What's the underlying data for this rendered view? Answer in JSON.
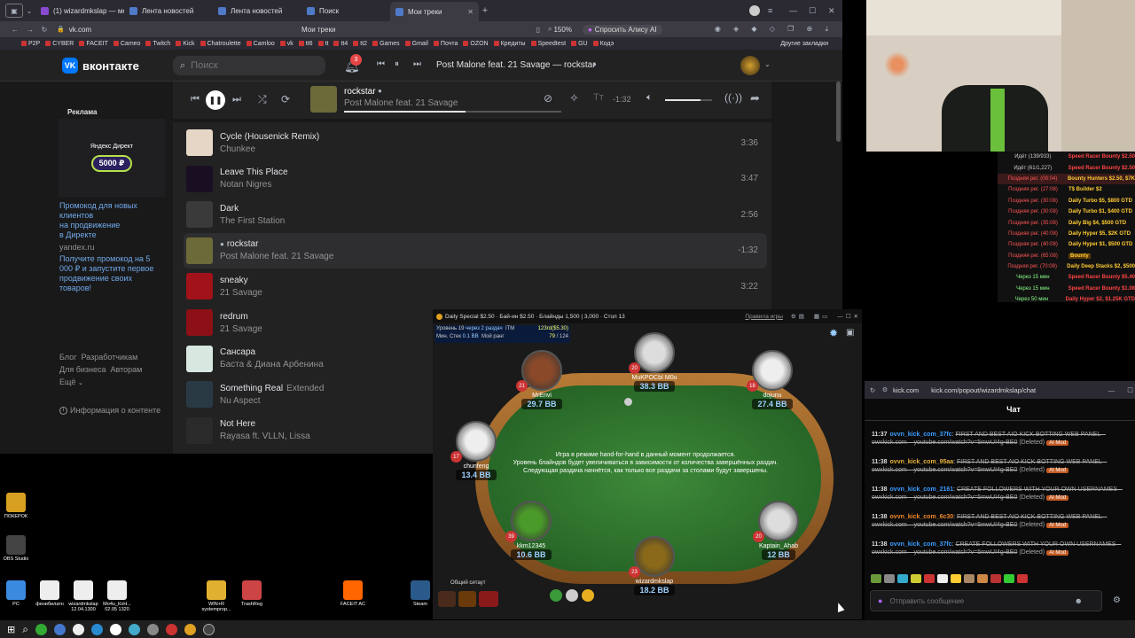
{
  "browser": {
    "tabs": [
      {
        "label": "(1) wizardmkslap — меню"
      },
      {
        "label": "Лента новостей"
      },
      {
        "label": "Лента новостей"
      },
      {
        "label": "Поиск"
      },
      {
        "label": "Мои треки"
      }
    ],
    "url": "vk.com",
    "page_title": "Мои треки",
    "zoom": "150%",
    "ask_alice": "Спросить Алису AI",
    "bookmarks": [
      "P2P",
      "CYBER",
      "FACEIT",
      "Cameo",
      "Twitch",
      "Kick",
      "Chatroulette",
      "Camloo",
      "vk",
      "tt6",
      "tt",
      "tt4",
      "tt2",
      "Games",
      "Gmail",
      "Почта",
      "OZON",
      "Кредиты",
      "Speedtest",
      "GU",
      "Кодэ"
    ],
    "other_bookmarks": "Другие закладки"
  },
  "vk": {
    "logo": "вконтакте",
    "search_placeholder": "Поиск",
    "notif_count": "3",
    "now_playing_header": "Post Malone feat. 21 Savage — rockstar"
  },
  "sidebar": {
    "ad_title": "Реклама",
    "ad_brand": "Яндекс Директ",
    "ad_amount": "5000 ₽",
    "promo_lines": [
      "Промокод для новых",
      "клиентов",
      "на продвижение",
      "в Директе"
    ],
    "promo_domain": "yandex.ru",
    "promo_desc": [
      "Получите промокод на 5",
      "000 ₽ и запустите первое",
      "продвижение своих",
      "товаров!"
    ],
    "footer_links": [
      "Блог",
      "Разработчикам",
      "Для бизнеса",
      "Авторам",
      "Ещё"
    ],
    "content_info": "Информация о контенте"
  },
  "player": {
    "title": "rockstar",
    "artist": "Post Malone feat. 21 Savage",
    "time": "-1:32",
    "progress": 0.56,
    "volume": 0.75
  },
  "tracks": [
    {
      "title": "Cycle (Housenick Remix)",
      "artist": "Chunkee",
      "duration": "3:36",
      "color": "#e6d6c6"
    },
    {
      "title": "Leave This Place",
      "artist": "Notan Nigres",
      "duration": "3:47",
      "color": "#1a0f22"
    },
    {
      "title": "Dark",
      "artist": "The First Station",
      "duration": "2:56",
      "color": "#3a3a3a"
    },
    {
      "title": "rockstar",
      "artist": "Post Malone feat. 21 Savage",
      "duration": "-1:32",
      "color": "#6d6a3a",
      "active": true
    },
    {
      "title": "sneaky",
      "artist": "21 Savage",
      "duration": "3:22",
      "color": "#a1121a"
    },
    {
      "title": "redrum",
      "artist": "21 Savage",
      "duration": "",
      "color": "#8c1016"
    },
    {
      "title": "Сансара",
      "artist": "Баста & Диана Арбенина",
      "duration": "",
      "color": "#d8e8e0"
    },
    {
      "title": "Something Real",
      "subtitle": "Extended",
      "artist": "Nu Aspect",
      "duration": "",
      "color": "#2a3a44"
    },
    {
      "title": "Not Here",
      "artist": "Rayasa ft. VLLN, Lissa",
      "duration": "",
      "color": "#2a2a2a"
    }
  ],
  "tournaments": [
    {
      "status": "Идёт (139/933)",
      "name": "Speed Racer Bounty $2.50",
      "c": "#ccc",
      "nc": "#f44"
    },
    {
      "status": "Идёт (61/1,227)",
      "name": "Speed Racer Bounty $2.50",
      "c": "#ccc",
      "nc": "#f44"
    },
    {
      "status": "Поздняя рег. (08:04)",
      "name": "Bounty Hunters $2.50, $7K",
      "c": "#f55",
      "nc": "#fc3",
      "hl": true
    },
    {
      "status": "Поздняя рег. (27:08)",
      "name": "T$ Builder $2",
      "c": "#f55",
      "nc": "#fc3"
    },
    {
      "status": "Поздняя рег. (30:08)",
      "name": "Daily Turbo $5, $800 GTD",
      "c": "#f55",
      "nc": "#fc3"
    },
    {
      "status": "Поздняя рег. (30:08)",
      "name": "Daily Turbo $1, $400 GTD",
      "c": "#f55",
      "nc": "#fc3"
    },
    {
      "status": "Поздняя рег. (35:08)",
      "name": "Daily Big $4, $500 GTD",
      "c": "#f55",
      "nc": "#fc3"
    },
    {
      "status": "Поздняя рег. (40:08)",
      "name": "Daily Hyper $5, $2K GTD",
      "c": "#f55",
      "nc": "#fc3"
    },
    {
      "status": "Поздняя рег. (40:08)",
      "name": "Daily Hyper $1, $500 GTD",
      "c": "#f55",
      "nc": "#fc3"
    },
    {
      "status": "Поздняя рег. (65:08)",
      "name": "Bounty",
      "c": "#f55",
      "nc": "#fc3",
      "hl2": true
    },
    {
      "status": "Поздняя рег. (70:08)",
      "name": "Daily Deep Stacks $2, $500",
      "c": "#f55",
      "nc": "#fc3"
    },
    {
      "status": "Через 15 мин",
      "name": "Speed Racer Bounty $5.40",
      "c": "#8f8",
      "nc": "#f44"
    },
    {
      "status": "Через 15 мин",
      "name": "Speed Racer Bounty $1.08",
      "c": "#8f8",
      "nc": "#f44"
    },
    {
      "status": "Через 50 мин",
      "name": "Daily Hyper $2, $1.25K GTD",
      "c": "#8f8",
      "nc": "#f44"
    }
  ],
  "poker": {
    "title": "Daily Special $2.50 · Бай-ин $2.50 · Блайнды 1,500 | 3,000 · Стол 13",
    "rules": "Правила игры",
    "level": "Уровень 19",
    "next": "через 2 раздач",
    "itm": "ITM",
    "itm_val": "123rd($5.30)",
    "min_stack": "Мин. Стек",
    "min_stack_val": "0.1 BB",
    "rank": "Мой ранг",
    "rank_val": "79",
    "rank_total": "124",
    "message": [
      "Игра в режиме hand-for-hand в данный момент продолжается.",
      "Уровень блайндов будет увеличиваться в зависимости от количества завершённых раздач.",
      "Следующая раздача начнётся, как только все раздачи за столами будут завершены."
    ],
    "chat_label": "Общий ситаут",
    "players": [
      {
        "name": "MrEnvi",
        "stack": "29.7 BB",
        "level": "21",
        "color": "#8a4a2a"
      },
      {
        "name": "MuKPOCbI M0u",
        "stack": "38.3 BB",
        "level": "20",
        "color": "#ddd"
      },
      {
        "name": "dojunu",
        "stack": "27.4 BB",
        "level": "18",
        "color": "#eee"
      },
      {
        "name": "chunfeng",
        "stack": "13.4 BB",
        "level": "17",
        "color": "#eee"
      },
      {
        "name": "kkm12345",
        "stack": "10.6 BB",
        "level": "39",
        "color": "#4a9a2a"
      },
      {
        "name": "wizardmkslap",
        "stack": "18.2 BB",
        "level": "23",
        "color": "#8a6a1a"
      },
      {
        "name": "Kaptain_Ahab",
        "stack": "12 BB",
        "level": "20",
        "color": "#ddd"
      }
    ]
  },
  "kick": {
    "domain": "kick.com",
    "url": "kick.com/popout/wizardmkslap/chat",
    "title": "Чат",
    "input_placeholder": "Отправить сообщение",
    "deleted": "(Deleted)",
    "badge": "AI Mod",
    "messages": [
      {
        "time": "11:37",
        "user": "ovvn_kick_com_37fc",
        "color": "#3b9cff",
        "text": "FIRST AND BEST AIO KICK BOTTING WEB PANEL – owxkick.com – youtube.com/watch?v=5mwUI4g-BE0"
      },
      {
        "time": "11:38",
        "user": "ovvn_kick_com_95aa",
        "color": "#e8b23a",
        "text": "FIRST AND BEST AIO KICK BOTTING WEB PANEL – owxkick.com – youtube.com/watch?v=5mwUI4g-BE0"
      },
      {
        "time": "11:38",
        "user": "ovvn_kick_com_2161",
        "color": "#3b9cff",
        "text": "CREATE FOLLOWERS WITH YOUR OWN USERNAMES – owxkick.com – youtube.com/watch?v=5mwUI4g-BE0"
      },
      {
        "time": "11:38",
        "user": "ovvn_kick_com_6c30",
        "color": "#f0882a",
        "text": "FIRST AND BEST AIO KICK BOTTING WEB PANEL – owxkick.com – youtube.com/watch?v=5mwUI4g-BE0"
      },
      {
        "time": "11:38",
        "user": "ovvn_kick_com_37fc",
        "color": "#3b9cff",
        "text": "CREATE FOLLOWERS WITH YOUR OWN USERNAMES – owxkick.com – youtube.com/watch?v=5mwUI4g-BE0"
      }
    ]
  },
  "desktop": {
    "icons": [
      {
        "label": "ПОКЕРОК",
        "color": "#d8a020"
      },
      {
        "label": "OBS Studio",
        "color": "#444"
      },
      {
        "label": "PC",
        "color": "#3a8ae0"
      },
      {
        "label": "фенибилатн",
        "color": "#eee"
      },
      {
        "label": "wizardmkslap 12.04.1300",
        "color": "#eee"
      },
      {
        "label": "Мо4u_КоН... 02.05 1320",
        "color": "#eee"
      },
      {
        "label": "WIN+R systemprop...",
        "color": "#e0b030"
      },
      {
        "label": "TrashReg",
        "color": "#c44"
      },
      {
        "label": "FACEIT AC",
        "color": "#f60"
      },
      {
        "label": "Steam",
        "color": "#2a5a8a"
      }
    ]
  }
}
